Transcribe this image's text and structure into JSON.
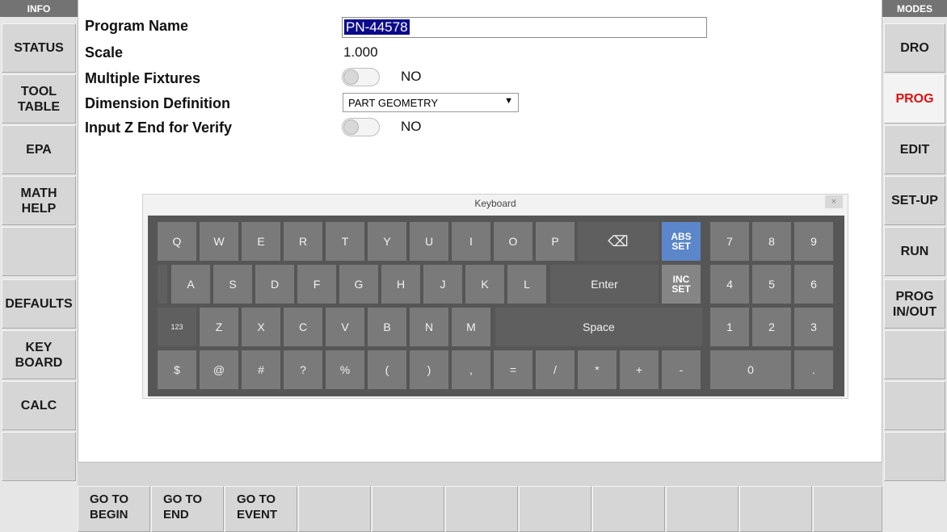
{
  "left_panel": {
    "header": "INFO",
    "buttons": [
      "STATUS",
      "TOOL\nTABLE",
      "EPA",
      "MATH\nHELP",
      "",
      "DEFAULTS",
      "KEY\nBOARD",
      "CALC",
      ""
    ]
  },
  "right_panel": {
    "header": "MODES",
    "buttons": [
      "DRO",
      "PROG",
      "EDIT",
      "SET-UP",
      "RUN",
      "PROG\nIN/OUT",
      "",
      "",
      ""
    ],
    "active": "PROG"
  },
  "form": {
    "program_name_label": "Program Name",
    "program_name_value": "PN-44578",
    "scale_label": "Scale",
    "scale_value": "1.000",
    "multiple_fixtures_label": "Multiple Fixtures",
    "multiple_fixtures_value": "NO",
    "dimension_definition_label": "Dimension Definition",
    "dimension_definition_value": "PART GEOMETRY",
    "input_z_end_label": "Input Z End for Verify",
    "input_z_end_value": "NO"
  },
  "keyboard": {
    "title": "Keyboard",
    "close": "×",
    "row1": [
      "Q",
      "W",
      "E",
      "R",
      "T",
      "Y",
      "U",
      "I",
      "O",
      "P"
    ],
    "backspace": "⌫",
    "abs_set": "ABS\nSET",
    "row2": [
      "A",
      "S",
      "D",
      "F",
      "G",
      "H",
      "J",
      "K",
      "L"
    ],
    "enter": "Enter",
    "inc_set": "INC\nSET",
    "toggle_123": "123",
    "row3": [
      "Z",
      "X",
      "C",
      "V",
      "B",
      "N",
      "M"
    ],
    "space": "Space",
    "row4": [
      "$",
      "@",
      "#",
      "?",
      "%",
      "(",
      ")",
      ",",
      "=",
      "/",
      "*",
      "+",
      "-"
    ],
    "numpad": [
      "7",
      "8",
      "9",
      "4",
      "5",
      "6",
      "1",
      "2",
      "3",
      "0",
      "."
    ]
  },
  "bottom": {
    "buttons": [
      "GO TO\nBEGIN",
      "GO TO\nEND",
      "GO TO\nEVENT",
      "",
      "",
      "",
      "",
      "",
      "",
      "",
      ""
    ]
  }
}
